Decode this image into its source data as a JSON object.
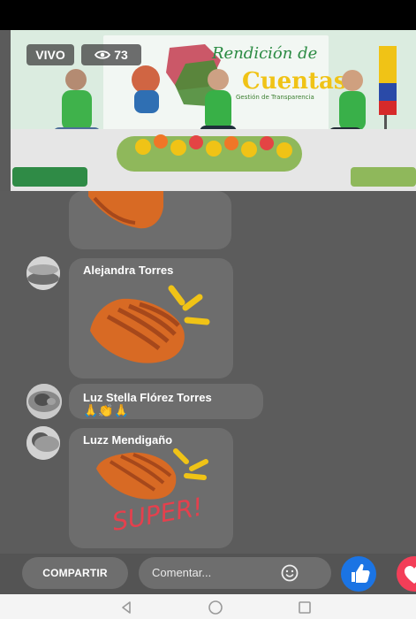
{
  "video": {
    "live_badge": "VIVO",
    "viewer_count": "73",
    "banner_title_line1": "Rendición de",
    "banner_title_line2": "Cuentas",
    "banner_subtitle": "Gestión de Transparencia"
  },
  "comments": [
    {
      "author": "",
      "emoji": ""
    },
    {
      "author": "Alejandra Torres",
      "emoji": ""
    },
    {
      "author": "Luz Stella Flórez Torres",
      "emoji": "🙏👏🙏"
    },
    {
      "author": "Luzz Mendigaño",
      "emoji": ""
    }
  ],
  "stickers": {
    "super_text": "SUPER!"
  },
  "actions": {
    "share_label": "COMPARTIR",
    "comment_placeholder": "Comentar..."
  },
  "icons": {
    "eye": "eye-icon",
    "like": "like-icon",
    "love": "love-icon",
    "emoji": "emoji-icon",
    "back": "back-icon",
    "home": "home-icon",
    "recent": "recent-apps-icon"
  },
  "colors": {
    "like_blue": "#1b74e4",
    "love_red": "#f33e58",
    "sticker_hand": "#d86a24",
    "sticker_burst": "#f0c316",
    "super_red": "#e5404d"
  }
}
